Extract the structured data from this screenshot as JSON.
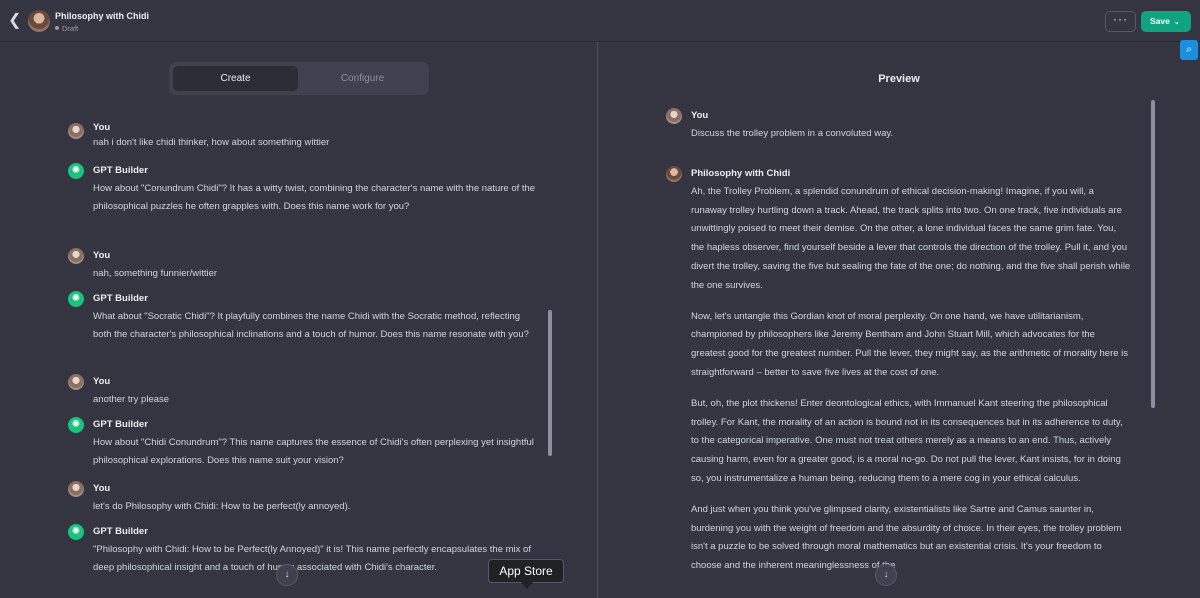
{
  "header": {
    "back_icon": "chevron-left-icon",
    "title": "Philosophy with Chidi",
    "status": "Draft",
    "more_label": "···",
    "save_label": "Save",
    "save_color": "#10a37f"
  },
  "tabs": {
    "create": "Create",
    "configure": "Configure"
  },
  "builder_chat": [
    {
      "author": "You",
      "text": "nah i don't like chidi thinker, how about something wittier"
    },
    {
      "author": "GPT Builder",
      "text": "How about \"Conundrum Chidi\"? It has a witty twist, combining the character's name with the nature of the philosophical puzzles he often grapples with. Does this name work for you?"
    },
    {
      "author": "You",
      "text": "nah, something funnier/wittier"
    },
    {
      "author": "GPT Builder",
      "text": "What about \"Socratic Chidi\"? It playfully combines the name Chidi with the Socratic method, reflecting both the character's philosophical inclinations and a touch of humor. Does this name resonate with you?"
    },
    {
      "author": "You",
      "text": "another try please"
    },
    {
      "author": "GPT Builder",
      "text": "How about \"Chidi Conundrum\"? This name captures the essence of Chidi's often perplexing yet insightful philosophical explorations. Does this name suit your vision?"
    },
    {
      "author": "You",
      "text": "let's do Philosophy with Chidi: How to be perfect(ly annoyed)."
    },
    {
      "author": "GPT Builder",
      "text": "\"Philosophy with Chidi: How to be Perfect(ly Annoyed)\" it is! This name perfectly encapsulates the mix of deep philosophical insight and a touch of humor associated with Chidi's character."
    }
  ],
  "tooltip": "App Store",
  "preview": {
    "title": "Preview",
    "user_author": "You",
    "user_text": "Discuss the trolley problem in a convoluted way.",
    "bot_author": "Philosophy with Chidi",
    "bot_paragraphs": [
      "Ah, the Trolley Problem, a splendid conundrum of ethical decision-making! Imagine, if you will, a runaway trolley hurtling down a track. Ahead, the track splits into two. On one track, five individuals are unwittingly poised to meet their demise. On the other, a lone individual faces the same grim fate. You, the hapless observer, find yourself beside a lever that controls the direction of the trolley. Pull it, and you divert the trolley, saving the five but sealing the fate of the one; do nothing, and the five shall perish while the one survives.",
      "Now, let's untangle this Gordian knot of moral perplexity. On one hand, we have utilitarianism, championed by philosophers like Jeremy Bentham and John Stuart Mill, which advocates for the greatest good for the greatest number. Pull the lever, they might say, as the arithmetic of morality here is straightforward – better to save five lives at the cost of one.",
      "But, oh, the plot thickens! Enter deontological ethics, with Immanuel Kant steering the philosophical trolley. For Kant, the morality of an action is bound not in its consequences but in its adherence to duty, to the categorical imperative. One must not treat others merely as a means to an end. Thus, actively causing harm, even for a greater good, is a moral no-go. Do not pull the lever, Kant insists, for in doing so, you instrumentalize a human being, reducing them to a mere cog in your ethical calculus.",
      "And just when you think you've glimpsed clarity, existentialists like Sartre and Camus saunter in, burdening you with the weight of freedom and the absurdity of choice. In their eyes, the trolley problem isn't a puzzle to be solved through moral mathematics but an existential crisis. It's your freedom to choose and the inherent meaninglessness of the"
    ]
  }
}
